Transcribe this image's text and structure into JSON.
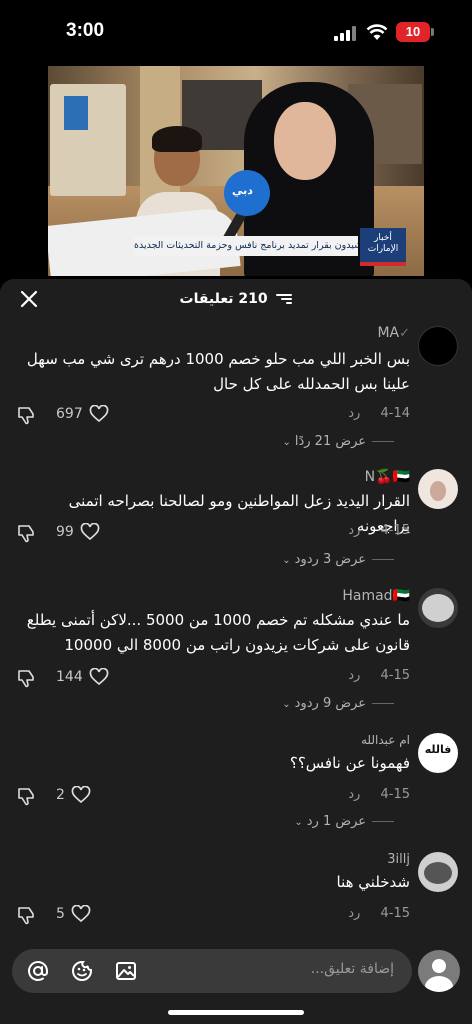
{
  "status_bar": {
    "time": "3:00",
    "battery": "10"
  },
  "video": {
    "ticker": "مواطنون يشيدون بقرار تمديد برنامج نافس وحزمة التحديثات الجديدة",
    "channel_logo": "أخبار الإمارات",
    "mic_label": "دبي"
  },
  "sheet": {
    "count_label": "210 تعليقات"
  },
  "comments": [
    {
      "username": "MA",
      "text": "بس الخبر اللي مب حلو خصم 1000 درهم ترى شي مب سهل علينا بس الحمدلله على كل حال",
      "date": "4-14",
      "reply_label": "رد",
      "likes": "697",
      "replies_label": "عرض 21 ردًا"
    },
    {
      "username": "N🍒🇦🇪",
      "text": "القرار اليديد زعل المواطنين ومو لصالحنا بصراحه اتمنى يراجعونه",
      "date": "4-15",
      "reply_label": "رد",
      "likes": "99",
      "replies_label": "عرض 3 ردود"
    },
    {
      "username": "Hamad🇦🇪",
      "text": "ما عندي مشكله تم خصم 1000 من 5000 ...لاكن أتمنى يطلع قانون على شركات يزيدون راتب من 8000 الي 10000",
      "date": "4-15",
      "reply_label": "رد",
      "likes": "144",
      "replies_label": "عرض 9 ردود"
    },
    {
      "username": "ام عبدالله",
      "text": "فهمونا عن نافس؟؟",
      "date": "4-15",
      "reply_label": "رد",
      "likes": "2",
      "replies_label": "عرض 1 رد"
    },
    {
      "username": "3illj",
      "text": "شدخلني هنا",
      "date": "4-15",
      "reply_label": "رد",
      "likes": "5",
      "replies_label": ""
    }
  ],
  "avatar_texts": {
    "um_abdullah": "فالله"
  },
  "input": {
    "placeholder": "إضافة تعليق..."
  }
}
